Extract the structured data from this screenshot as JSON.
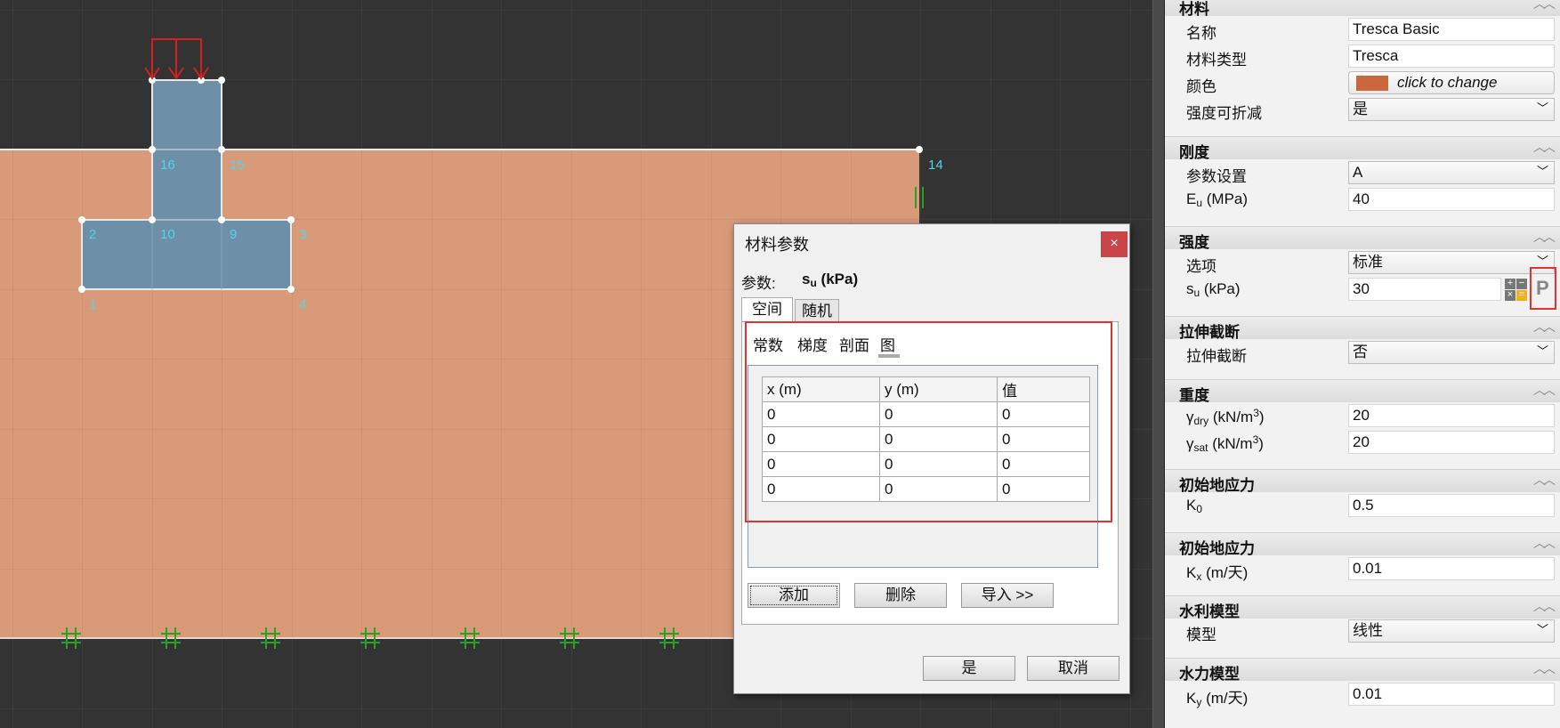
{
  "canvas": {
    "node_labels": [
      "16",
      "15",
      "14",
      "2",
      "10",
      "9",
      "3",
      "1",
      "4"
    ]
  },
  "panel": {
    "sections": {
      "material": "材料",
      "stiffness": "刚度",
      "strength": "强度",
      "tension_cutoff": "拉伸截断",
      "weight": "重度",
      "initial_stress_1": "初始地应力",
      "initial_stress_2": "初始地应力",
      "hydro_model": "水利模型",
      "hydraulic_model": "水力模型"
    },
    "props": {
      "name_label": "名称",
      "name_value": "Tresca Basic",
      "type_label": "材料类型",
      "type_value": "Tresca",
      "color_label": "颜色",
      "color_value": "click to change",
      "color_swatch": "#c8683c",
      "reducible_label": "强度可折减",
      "reducible_value": "是",
      "param_label": "参数设置",
      "param_value": "A",
      "eu_label_main": "E",
      "eu_label_sub": "u",
      "eu_label_unit": " (MPa)",
      "eu_value": "40",
      "option_label": "选项",
      "option_value": "标准",
      "su_label_main": "s",
      "su_label_sub": "u",
      "su_label_unit": " (kPa)",
      "su_value": "30",
      "p_icon_text": "P",
      "cutoff_label": "拉伸截断",
      "cutoff_value": "否",
      "gdry_main": "γ",
      "gdry_sub": "dry",
      "gdry_unit": " (kN/m",
      "gdry_sup": "3",
      "gdry_close": ")",
      "gdry_value": "20",
      "gsat_main": "γ",
      "gsat_sub": "sat",
      "gsat_unit": " (kN/m",
      "gsat_sup": "3",
      "gsat_close": ")",
      "gsat_value": "20",
      "k0_main": "K",
      "k0_sub": "0",
      "k0_value": "0.5",
      "kx_main": "K",
      "kx_sub": "x",
      "kx_unit": " (m/天)",
      "kx_value": "0.01",
      "model_label": "模型",
      "model_value": "线性",
      "ky_main": "K",
      "ky_sub": "y",
      "ky_unit": " (m/天)",
      "ky_value": "0.01"
    }
  },
  "dialog": {
    "title": "材料参数",
    "close": "×",
    "param_label": "参数:",
    "param_main": "s",
    "param_sub": "u",
    "param_unit": " (kPa)",
    "tabs": [
      "空间",
      "随机"
    ],
    "subtabs": [
      "常数",
      "梯度",
      "剖面",
      "图"
    ],
    "table": {
      "headers": [
        "x (m)",
        "y (m)",
        "值"
      ],
      "rows": [
        [
          "0",
          "0",
          "0"
        ],
        [
          "0",
          "0",
          "0"
        ],
        [
          "0",
          "0",
          "0"
        ],
        [
          "0",
          "0",
          "0"
        ]
      ]
    },
    "add_button": "添加",
    "delete_button": "删除",
    "import_button": "导入 >>",
    "ok_button": "是",
    "cancel_button": "取消"
  }
}
